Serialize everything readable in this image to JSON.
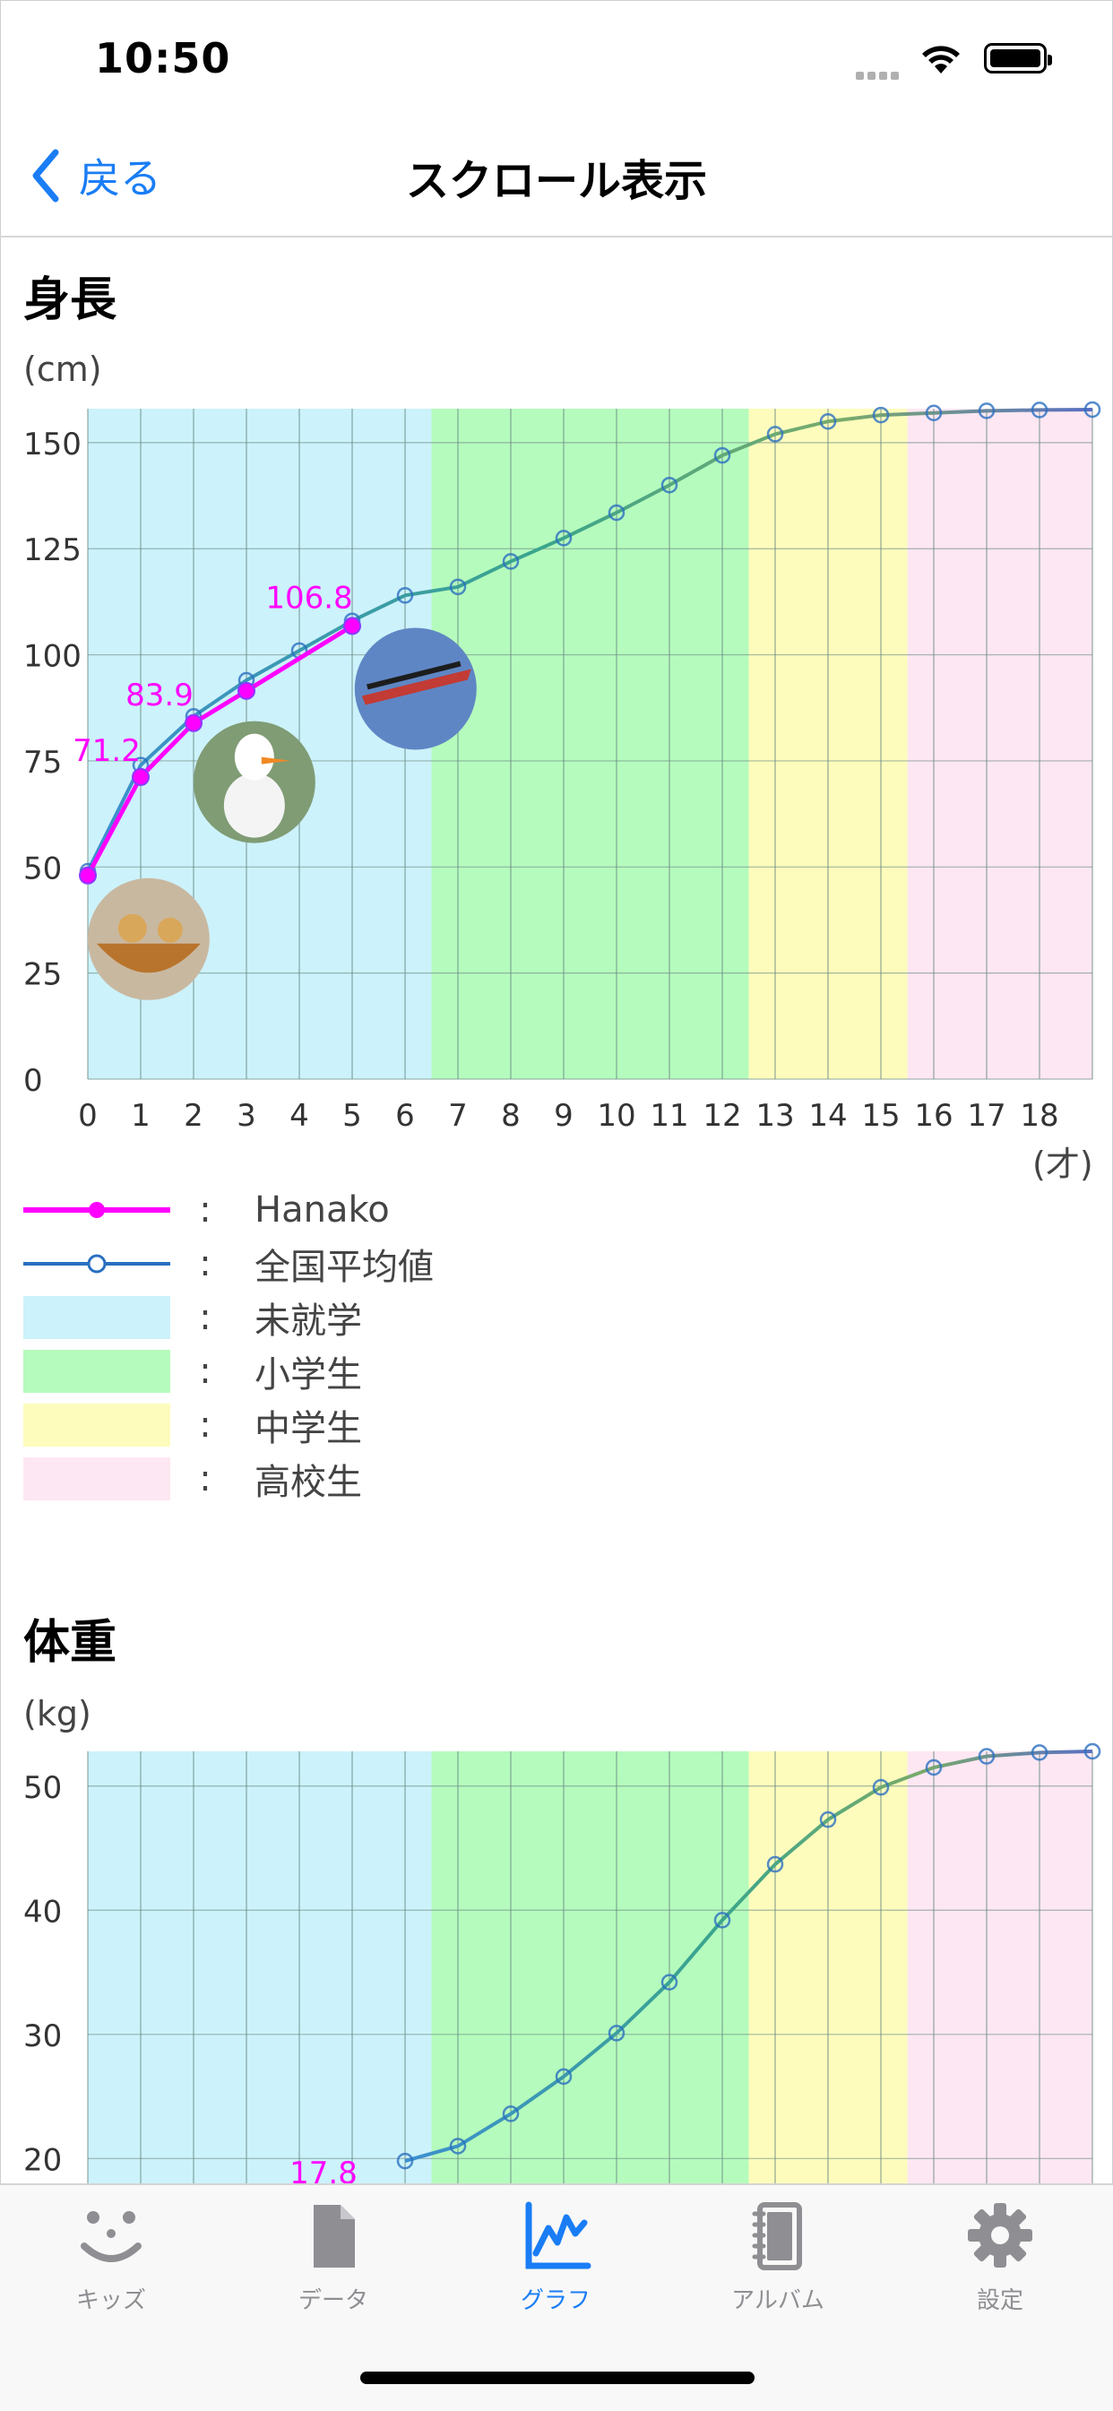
{
  "status_bar": {
    "time": "10:50"
  },
  "nav": {
    "back_label": "戻る",
    "title": "スクロール表示"
  },
  "height_section": {
    "title": "身長",
    "unit": "(cm)",
    "x_unit": "(才)"
  },
  "weight_section": {
    "title": "体重",
    "unit": "(kg)"
  },
  "legend": [
    {
      "label": "Hanako",
      "kind": "line-dot",
      "color": "#ff00ff"
    },
    {
      "label": "全国平均値",
      "kind": "line-circle",
      "color": "#2a6fc0"
    },
    {
      "label": "未就学",
      "kind": "band",
      "color": "#ccf2fb"
    },
    {
      "label": "小学生",
      "kind": "band",
      "color": "#b5fbbd"
    },
    {
      "label": "中学生",
      "kind": "band",
      "color": "#fdfcbc"
    },
    {
      "label": "高校生",
      "kind": "band",
      "color": "#fde7f2"
    }
  ],
  "colors": {
    "accent": "#1a7df5",
    "hanako": "#ff00ff",
    "average": "#2a6fc0",
    "preschool": "#ccf2fb",
    "elementary": "#b5fbbd",
    "junior_high": "#fdfcbc",
    "high_school": "#fde7f2"
  },
  "chart_data": [
    {
      "type": "line",
      "title": "身長",
      "ylabel": "(cm)",
      "xlabel": "(才)",
      "ylim": [
        0,
        158
      ],
      "xlim": [
        0,
        19
      ],
      "yticks": [
        0,
        25,
        50,
        75,
        100,
        125,
        150
      ],
      "xticks": [
        0,
        1,
        2,
        3,
        4,
        5,
        6,
        7,
        8,
        9,
        10,
        11,
        12,
        13,
        14,
        15,
        16,
        17,
        18
      ],
      "bands": [
        {
          "name": "未就学",
          "from": 0,
          "to": 6.5,
          "color": "#ccf2fb"
        },
        {
          "name": "小学生",
          "from": 6.5,
          "to": 12.5,
          "color": "#b5fbbd"
        },
        {
          "name": "中学生",
          "from": 12.5,
          "to": 15.5,
          "color": "#fdfcbc"
        },
        {
          "name": "高校生",
          "from": 15.5,
          "to": 19,
          "color": "#fde7f2"
        }
      ],
      "series": [
        {
          "name": "全国平均値",
          "x": [
            0,
            1,
            2,
            3,
            4,
            5,
            6,
            7,
            8,
            9,
            10,
            11,
            12,
            13,
            14,
            15,
            16,
            17,
            18,
            19
          ],
          "values": [
            49,
            74,
            85.5,
            94,
            101,
            108,
            114,
            116,
            122,
            127.5,
            133.5,
            140,
            147,
            152,
            155,
            156.5,
            157,
            157.5,
            157.7,
            157.8
          ]
        },
        {
          "name": "Hanako",
          "x": [
            0,
            1,
            2,
            3,
            5
          ],
          "values": [
            48,
            71.2,
            83.9,
            91.5,
            106.8
          ],
          "labels": [
            "",
            "71.2",
            "83.9",
            "",
            "106.8"
          ]
        }
      ],
      "photos": [
        {
          "x": 1.15,
          "y": 33,
          "subject": "teddy-bears-in-basket"
        },
        {
          "x": 3.15,
          "y": 70,
          "subject": "snowman-figure"
        },
        {
          "x": 6.2,
          "y": 92,
          "subject": "flying-jets"
        }
      ],
      "grid": true
    },
    {
      "type": "line",
      "title": "体重",
      "ylabel": "(kg)",
      "ylim": [
        18,
        52.8
      ],
      "xlim": [
        0,
        19
      ],
      "yticks": [
        20,
        30,
        40,
        50
      ],
      "series": [
        {
          "name": "全国平均値",
          "x": [
            6,
            7,
            8,
            9,
            10,
            11,
            12,
            13,
            14,
            15,
            16,
            17,
            18,
            19
          ],
          "values": [
            19.8,
            21,
            23.6,
            26.6,
            30.1,
            34.2,
            39.2,
            43.7,
            47.3,
            49.9,
            51.5,
            52.4,
            52.7,
            52.8
          ]
        },
        {
          "name": "Hanako",
          "x": [
            5
          ],
          "values": [
            17.8
          ],
          "labels": [
            "17.8"
          ]
        }
      ],
      "grid": true
    }
  ],
  "tabs": [
    {
      "label": "キッズ",
      "icon": "face-icon",
      "active": false
    },
    {
      "label": "データ",
      "icon": "document-icon",
      "active": false
    },
    {
      "label": "グラフ",
      "icon": "chart-icon",
      "active": true
    },
    {
      "label": "アルバム",
      "icon": "album-icon",
      "active": false
    },
    {
      "label": "設定",
      "icon": "gear-icon",
      "active": false
    }
  ]
}
